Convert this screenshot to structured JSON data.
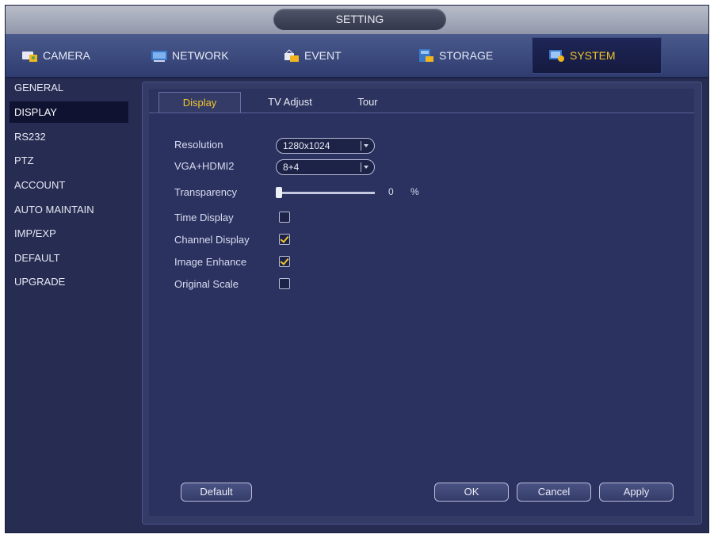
{
  "window": {
    "title": "SETTING"
  },
  "topnav": [
    {
      "label": "CAMERA",
      "icon": "camera-icon",
      "active": false
    },
    {
      "label": "NETWORK",
      "icon": "network-icon",
      "active": false
    },
    {
      "label": "EVENT",
      "icon": "event-icon",
      "active": false
    },
    {
      "label": "STORAGE",
      "icon": "storage-icon",
      "active": false
    },
    {
      "label": "SYSTEM",
      "icon": "system-icon",
      "active": true
    }
  ],
  "sidebar": [
    {
      "label": "GENERAL",
      "active": false
    },
    {
      "label": "DISPLAY",
      "active": true
    },
    {
      "label": "RS232",
      "active": false
    },
    {
      "label": "PTZ",
      "active": false
    },
    {
      "label": "ACCOUNT",
      "active": false
    },
    {
      "label": "AUTO MAINTAIN",
      "active": false
    },
    {
      "label": "IMP/EXP",
      "active": false
    },
    {
      "label": "DEFAULT",
      "active": false
    },
    {
      "label": "UPGRADE",
      "active": false
    }
  ],
  "tabs": [
    {
      "label": "Display",
      "active": true
    },
    {
      "label": "TV Adjust",
      "active": false
    },
    {
      "label": "Tour",
      "active": false
    }
  ],
  "form": {
    "resolution": {
      "label": "Resolution",
      "value": "1280x1024"
    },
    "vga_hdmi": {
      "label": "VGA+HDMI2",
      "value": "8+4"
    },
    "transparency": {
      "label": "Transparency",
      "value": "0",
      "unit": "%",
      "level": 0
    },
    "time_display": {
      "label": "Time Display",
      "checked": false
    },
    "channel_display": {
      "label": "Channel Display",
      "checked": true
    },
    "image_enhance": {
      "label": "Image Enhance",
      "checked": true
    },
    "original_scale": {
      "label": "Original Scale",
      "checked": false
    }
  },
  "buttons": {
    "default": "Default",
    "ok": "OK",
    "cancel": "Cancel",
    "apply": "Apply"
  },
  "colors": {
    "accent": "#f0c52a",
    "background": "#272c52"
  }
}
